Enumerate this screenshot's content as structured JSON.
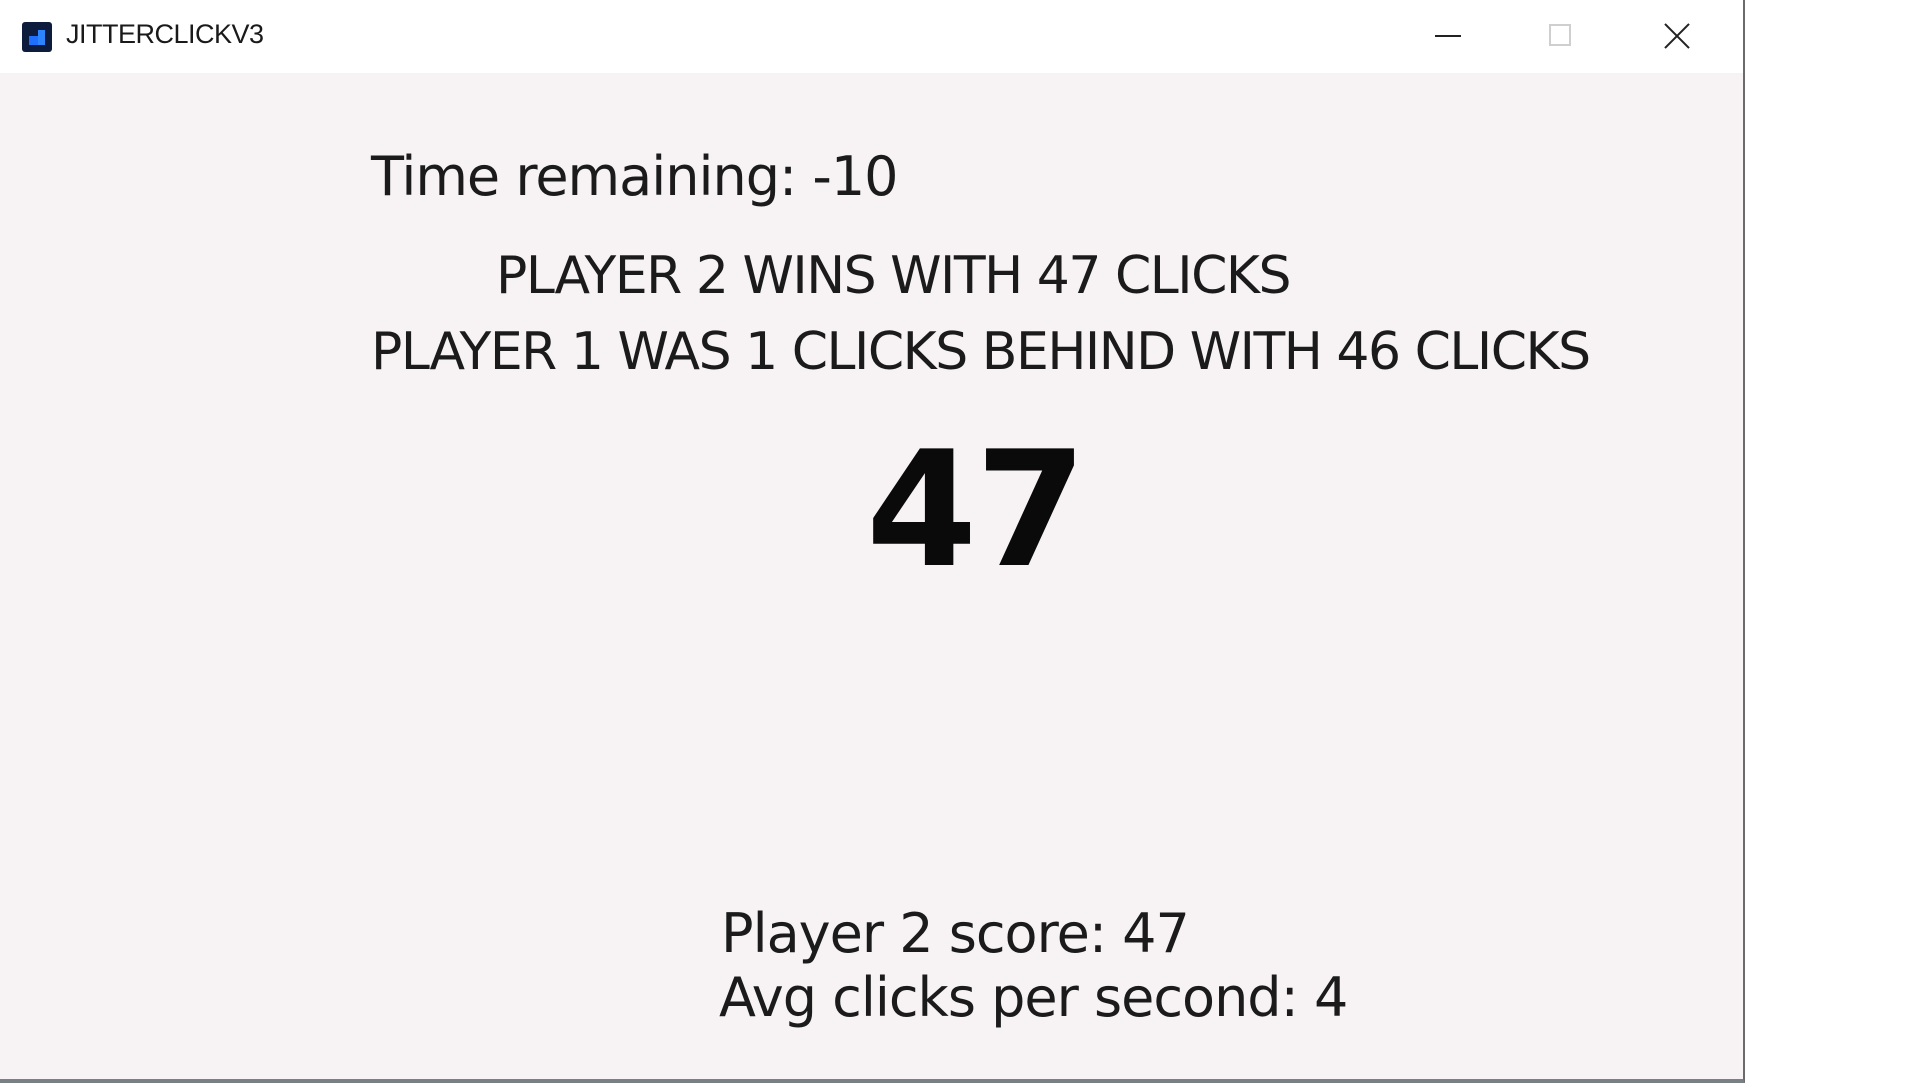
{
  "window": {
    "title": "JITTERCLICKV3",
    "icon": "app-icon",
    "controls": {
      "minimize": "minimize-icon",
      "maximize": "maximize-icon",
      "close": "close-icon"
    }
  },
  "game": {
    "time_remaining": "Time remaining: -10",
    "winner_line": "PLAYER 2 WINS WITH 47 CLICKS",
    "loser_line": "PLAYER 1 WAS 1 CLICKS BEHIND WITH 46 CLICKS",
    "current_score": "47",
    "player_score": "Player 2 score: 47",
    "avg_cps": "Avg clicks per second: 4"
  },
  "colors": {
    "client_background": "#f7f3f4",
    "titlebar_background": "#ffffff",
    "text": "#1b1b1b",
    "icon_accent": "#1f6fff"
  }
}
